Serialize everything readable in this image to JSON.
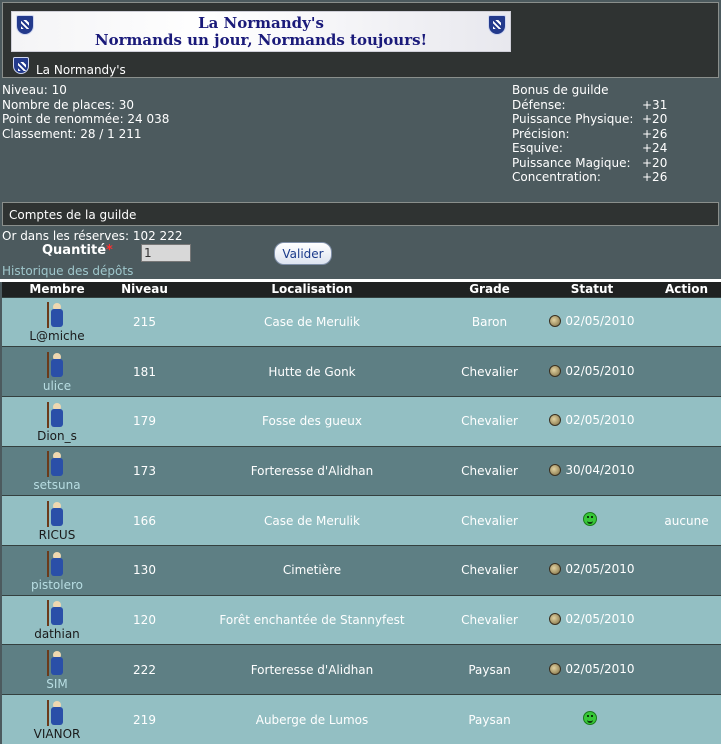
{
  "banner": {
    "line1": "La Normandy's",
    "line2": "Normands un jour, Normands toujours!"
  },
  "guild": {
    "name": "La Normandy's"
  },
  "stats": {
    "level": "Niveau: 10",
    "places": "Nombre de places: 30",
    "renown": "Point de renommée: 24 038",
    "ranking": "Classement: 28 / 1 211"
  },
  "bonus": {
    "title": "Bonus de guilde",
    "items": [
      {
        "label": "Défense:",
        "value": "+31"
      },
      {
        "label": "Puissance Physique:",
        "value": "+20"
      },
      {
        "label": "Précision:",
        "value": "+26"
      },
      {
        "label": "Esquive:",
        "value": "+24"
      },
      {
        "label": "Puissance Magique:",
        "value": "+20"
      },
      {
        "label": "Concentration:",
        "value": "+26"
      }
    ]
  },
  "accounts": {
    "title": "Comptes de la guilde",
    "gold": "Or dans les réserves: 102 222",
    "quantity_label": "Quantité",
    "required_mark": "*",
    "quantity_value": "1",
    "submit_label": "Valider",
    "history_link": "Historique des dépôts"
  },
  "table": {
    "headers": [
      "Membre",
      "Niveau",
      "Localisation",
      "Grade",
      "Statut",
      "Action"
    ],
    "rows": [
      {
        "name": "L@miche",
        "name_style": "plain",
        "level": "215",
        "location": "Case de Merulik",
        "grade": "Baron",
        "status_icon": "moon-icon",
        "status": "02/05/2010",
        "action": ""
      },
      {
        "name": "ulice",
        "name_style": "link",
        "level": "181",
        "location": "Hutte de Gonk",
        "grade": "Chevalier",
        "status_icon": "moon-icon",
        "status": "02/05/2010",
        "action": ""
      },
      {
        "name": "Dion_s",
        "name_style": "plain",
        "level": "179",
        "location": "Fosse des gueux",
        "grade": "Chevalier",
        "status_icon": "moon-icon",
        "status": "02/05/2010",
        "action": ""
      },
      {
        "name": "setsuna",
        "name_style": "link",
        "level": "173",
        "location": "Forteresse d'Alidhan",
        "grade": "Chevalier",
        "status_icon": "moon-icon",
        "status": "30/04/2010",
        "action": ""
      },
      {
        "name": "RICUS",
        "name_style": "plain",
        "level": "166",
        "location": "Case de Merulik",
        "grade": "Chevalier",
        "status_icon": "smile-icon",
        "status": "",
        "action": "aucune"
      },
      {
        "name": "pistolero",
        "name_style": "link",
        "level": "130",
        "location": "Cimetière",
        "grade": "Chevalier",
        "status_icon": "moon-icon",
        "status": "02/05/2010",
        "action": ""
      },
      {
        "name": "dathian",
        "name_style": "plain",
        "level": "120",
        "location": "Forêt enchantée de Stannyfest",
        "grade": "Chevalier",
        "status_icon": "moon-icon",
        "status": "02/05/2010",
        "action": ""
      },
      {
        "name": "SIM",
        "name_style": "link",
        "level": "222",
        "location": "Forteresse d'Alidhan",
        "grade": "Paysan",
        "status_icon": "moon-icon",
        "status": "02/05/2010",
        "action": ""
      },
      {
        "name": "VIANOR",
        "name_style": "plain",
        "level": "219",
        "location": "Auberge de Lumos",
        "grade": "Paysan",
        "status_icon": "smile-icon",
        "status": "",
        "action": ""
      }
    ]
  }
}
